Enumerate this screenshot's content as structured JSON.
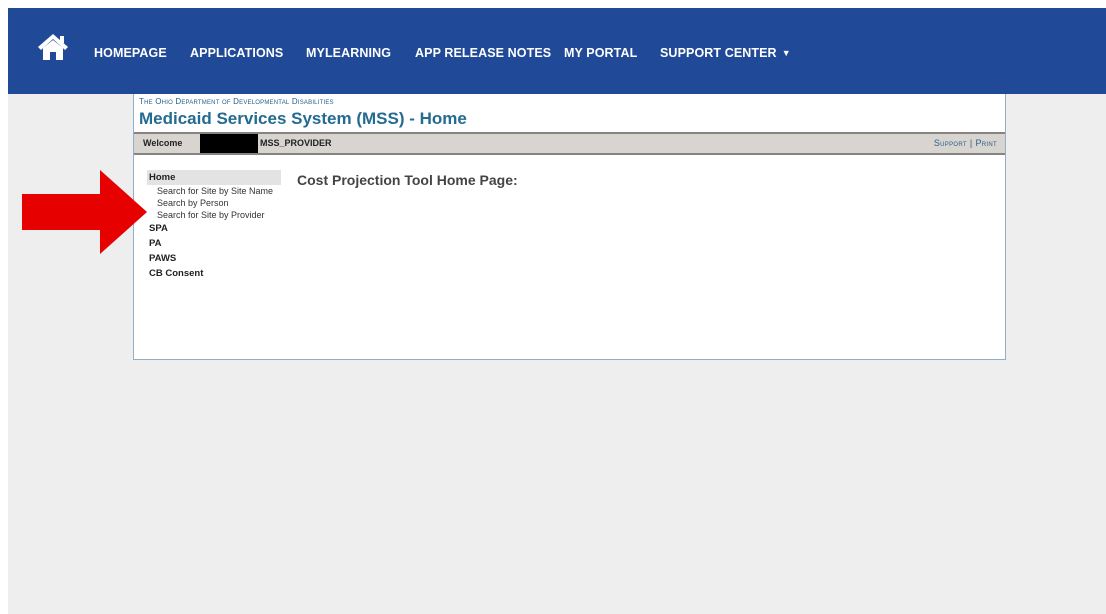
{
  "colors": {
    "navbar_bg": "#204a98",
    "title_blue": "#246b91",
    "arrow_red": "#e60000"
  },
  "navbar": {
    "home_icon": "home-icon",
    "items": [
      {
        "label": "HOMEPAGE"
      },
      {
        "label": "APPLICATIONS"
      },
      {
        "label": "MYLEARNING"
      },
      {
        "label": "APP RELEASE NOTES"
      },
      {
        "label": "MY PORTAL"
      },
      {
        "label": "SUPPORT CENTER",
        "dropdown_icon": "caret-down-icon"
      }
    ]
  },
  "header": {
    "department": "The Ohio Department of Developmental Disabilities",
    "title": "Medicaid Services System (MSS) - Home"
  },
  "welcome_bar": {
    "welcome_label": "Welcome",
    "user_role": "MSS_PROVIDER",
    "support_link": "Support",
    "separator": "|",
    "print_link": "Print"
  },
  "sidenav": {
    "home": {
      "label": "Home",
      "links": [
        "Search for Site by Site Name",
        "Search by Person",
        "Search for Site by Provider"
      ]
    },
    "sections": [
      "SPA",
      "PA",
      "PAWS",
      "CB Consent"
    ]
  },
  "content": {
    "title": "Cost Projection Tool Home Page:"
  },
  "annotation": {
    "arrow_icon": "red-arrow-icon"
  }
}
